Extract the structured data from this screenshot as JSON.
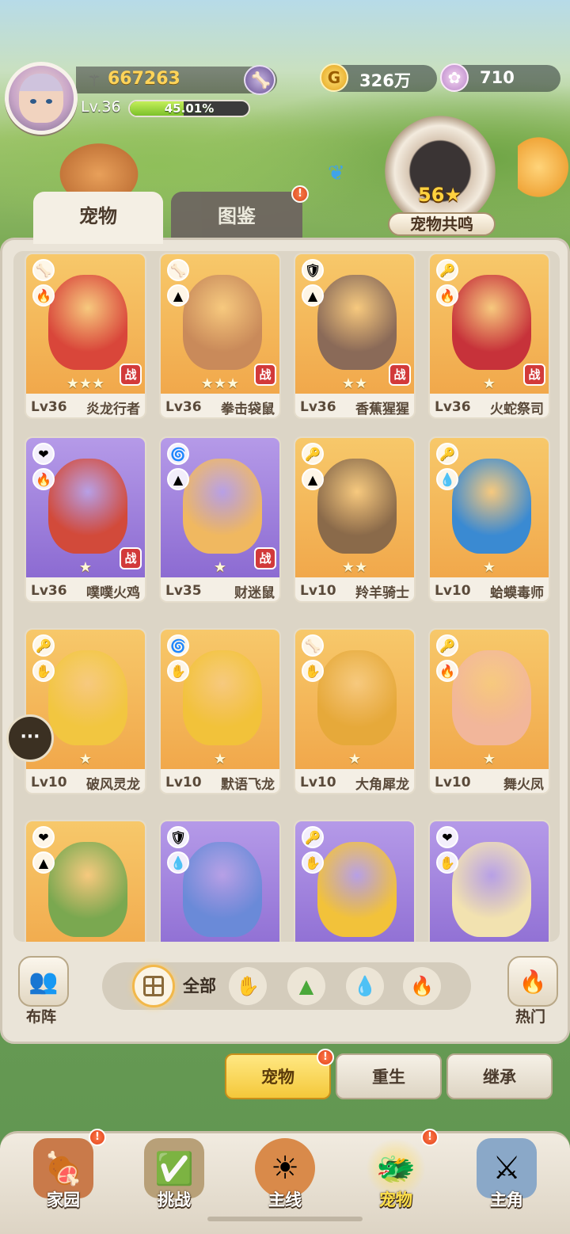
{
  "player": {
    "power": "667263",
    "level": "Lv.36",
    "xp_percent": "45.01%",
    "xp_fraction": 0.4501
  },
  "currencies": {
    "gold": "326万",
    "shells": "710"
  },
  "resonance": {
    "count": "56★",
    "label": "宠物共鸣"
  },
  "tabs": {
    "pets": "宠物",
    "codex": "图鉴",
    "codex_alert": "!"
  },
  "pets": [
    {
      "level": "Lv36",
      "name": "炎龙行者",
      "stars": "★★★",
      "rarity": "gold",
      "battle": "战",
      "elem1": "🦴",
      "elem2": "🔥",
      "color": "#d9463a"
    },
    {
      "level": "Lv36",
      "name": "拳击袋鼠",
      "stars": "★★★",
      "rarity": "gold",
      "battle": "战",
      "elem1": "🦴",
      "elem2": "▲",
      "color": "#c98a5a"
    },
    {
      "level": "Lv36",
      "name": "香蕉猩猩",
      "stars": "★★",
      "rarity": "gold",
      "battle": "战",
      "elem1": "🛡",
      "elem2": "▲",
      "color": "#8a6a58"
    },
    {
      "level": "Lv36",
      "name": "火蛇祭司",
      "stars": "★",
      "rarity": "gold",
      "battle": "战",
      "elem1": "🔑",
      "elem2": "🔥",
      "color": "#c7323a"
    },
    {
      "level": "Lv36",
      "name": "噗噗火鸡",
      "stars": "★",
      "rarity": "purple",
      "battle": "战",
      "elem1": "❤",
      "elem2": "🔥",
      "color": "#d24a3a"
    },
    {
      "level": "Lv35",
      "name": "财迷鼠",
      "stars": "★",
      "rarity": "purple",
      "battle": "战",
      "elem1": "🌀",
      "elem2": "▲",
      "color": "#f0b860"
    },
    {
      "level": "Lv10",
      "name": "羚羊骑士",
      "stars": "★★",
      "rarity": "gold",
      "battle": "",
      "elem1": "🔑",
      "elem2": "▲",
      "color": "#8a6a4a"
    },
    {
      "level": "Lv10",
      "name": "蛤蟆毒师",
      "stars": "★",
      "rarity": "gold",
      "battle": "",
      "elem1": "🔑",
      "elem2": "💧",
      "color": "#3a8ad2"
    },
    {
      "level": "Lv10",
      "name": "破风灵龙",
      "stars": "★",
      "rarity": "gold",
      "battle": "",
      "elem1": "🔑",
      "elem2": "✋",
      "color": "#f2c640"
    },
    {
      "level": "Lv10",
      "name": "默语飞龙",
      "stars": "★",
      "rarity": "gold",
      "battle": "",
      "elem1": "🌀",
      "elem2": "✋",
      "color": "#f2c23a"
    },
    {
      "level": "Lv10",
      "name": "大角犀龙",
      "stars": "★",
      "rarity": "gold",
      "battle": "",
      "elem1": "🦴",
      "elem2": "✋",
      "color": "#e6a93a"
    },
    {
      "level": "Lv10",
      "name": "舞火凤",
      "stars": "★",
      "rarity": "gold",
      "battle": "",
      "elem1": "🔑",
      "elem2": "🔥",
      "color": "#f2b69a"
    },
    {
      "level": "",
      "name": "",
      "stars": "",
      "rarity": "gold",
      "battle": "",
      "elem1": "❤",
      "elem2": "▲",
      "color": "#7aa850"
    },
    {
      "level": "",
      "name": "",
      "stars": "",
      "rarity": "purple",
      "battle": "",
      "elem1": "🛡",
      "elem2": "💧",
      "color": "#6a8ad8"
    },
    {
      "level": "",
      "name": "",
      "stars": "",
      "rarity": "purple",
      "battle": "",
      "elem1": "🔑",
      "elem2": "✋",
      "color": "#f2c23a"
    },
    {
      "level": "",
      "name": "",
      "stars": "",
      "rarity": "purple",
      "battle": "",
      "elem1": "❤",
      "elem2": "✋",
      "color": "#f2e2b0"
    }
  ],
  "filters": {
    "lineup": "布阵",
    "all": "全部",
    "elements": [
      {
        "icon": "✋",
        "color": "#e8b52a"
      },
      {
        "icon": "▲",
        "color": "#4aa83a"
      },
      {
        "icon": "💧",
        "color": "#2a8ad8"
      },
      {
        "icon": "🔥",
        "color": "#e04a2a"
      }
    ],
    "hot": "热门",
    "hot_icon": "🔥"
  },
  "chat": {
    "icon": "···"
  },
  "sub_actions": {
    "pets": "宠物",
    "pets_alert": "!",
    "rebirth": "重生",
    "inherit": "继承"
  },
  "nav": [
    {
      "label": "家园",
      "icon": "🍖",
      "alert": "!"
    },
    {
      "label": "挑战",
      "icon": "✅",
      "alert": ""
    },
    {
      "label": "主线",
      "icon": "☀",
      "alert": ""
    },
    {
      "label": "宠物",
      "icon": "🐲",
      "alert": "!"
    },
    {
      "label": "主角",
      "icon": "⚔",
      "alert": ""
    }
  ]
}
